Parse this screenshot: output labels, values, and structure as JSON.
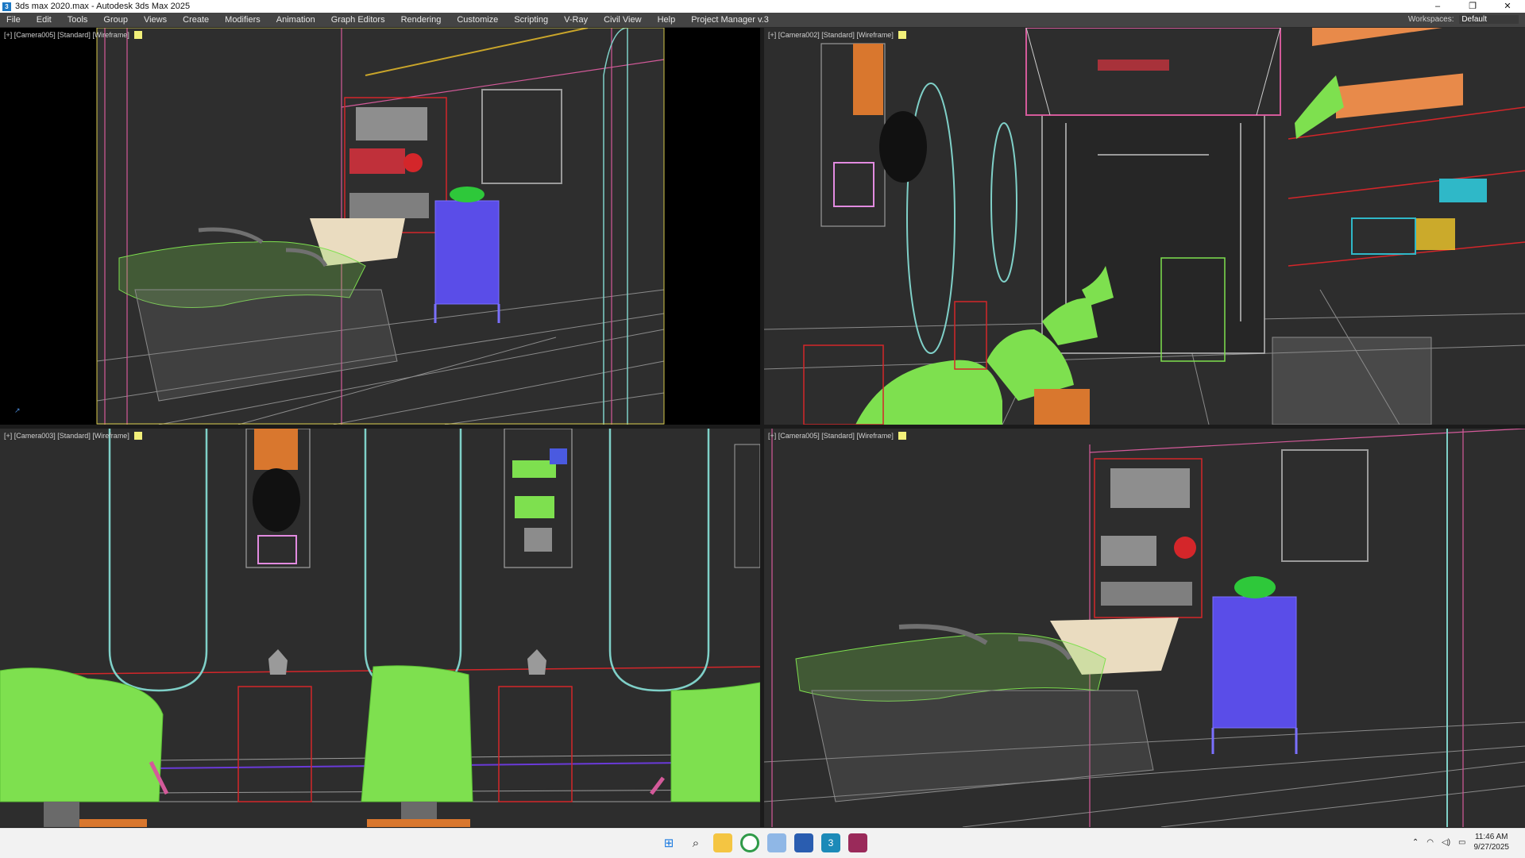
{
  "window": {
    "title": "3ds max 2020.max - Autodesk 3ds Max 2025",
    "app_icon": "3",
    "controls": [
      "–",
      "❐",
      "✕"
    ]
  },
  "menu": {
    "items": [
      "File",
      "Edit",
      "Tools",
      "Group",
      "Views",
      "Create",
      "Modifiers",
      "Animation",
      "Graph Editors",
      "Rendering",
      "Customize",
      "Scripting",
      "V-Ray",
      "Civil View",
      "Help",
      "Project Manager v.3"
    ],
    "workspace_label": "Workspaces:",
    "workspace_value": "Default"
  },
  "viewports": {
    "top_left": {
      "label": "[+] [Camera005] [Standard] [Wireframe]"
    },
    "top_right": {
      "label": "[+] [Camera002] [Standard] [Wireframe]"
    },
    "bottom_left": {
      "label": "[+] [Camera003] [Standard] [Wireframe]"
    },
    "bottom_right": {
      "label": "[+] [Camera005] [Standard] [Wireframe]"
    }
  },
  "taskbar": {
    "apps": [
      "windows-start-icon",
      "search-icon",
      "file-explorer-icon",
      "chrome-icon",
      "photos-icon",
      "notepad-icon",
      "3ds-max-icon",
      "winrar-icon"
    ],
    "time": "11:46 AM",
    "date": "9/27/2025"
  },
  "colors": {
    "chair_green": "#7ee04f",
    "stand_red": "#d4262a",
    "cart_blue": "#5a4de8",
    "cabinet_orange": "#d9772e",
    "mirror_cyan": "#7fd0c8",
    "wall_pink": "#d45a9a",
    "accent_yellow": "#f2f07a"
  }
}
